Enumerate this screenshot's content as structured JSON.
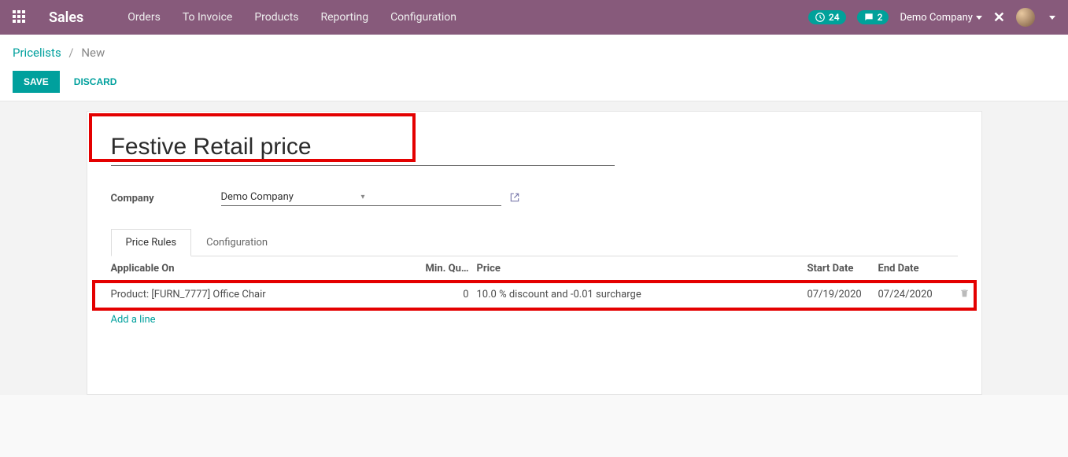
{
  "nav": {
    "brand": "Sales",
    "menu": [
      "Orders",
      "To Invoice",
      "Products",
      "Reporting",
      "Configuration"
    ],
    "activity_count": "24",
    "message_count": "2",
    "company": "Demo Company"
  },
  "breadcrumb": {
    "parent": "Pricelists",
    "current": "New"
  },
  "actions": {
    "save": "SAVE",
    "discard": "DISCARD"
  },
  "form": {
    "title": "Festive Retail price",
    "company_label": "Company",
    "company_value": "Demo Company"
  },
  "tabs": {
    "price_rules": "Price Rules",
    "configuration": "Configuration"
  },
  "table": {
    "headers": {
      "applicable": "Applicable On",
      "min_qty": "Min. Qu…",
      "price": "Price",
      "start": "Start Date",
      "end": "End Date"
    },
    "rows": [
      {
        "applicable": "Product: [FURN_7777] Office Chair",
        "min_qty": "0",
        "price": "10.0 % discount and -0.01 surcharge",
        "start": "07/19/2020",
        "end": "07/24/2020"
      }
    ],
    "add_line": "Add a line"
  }
}
